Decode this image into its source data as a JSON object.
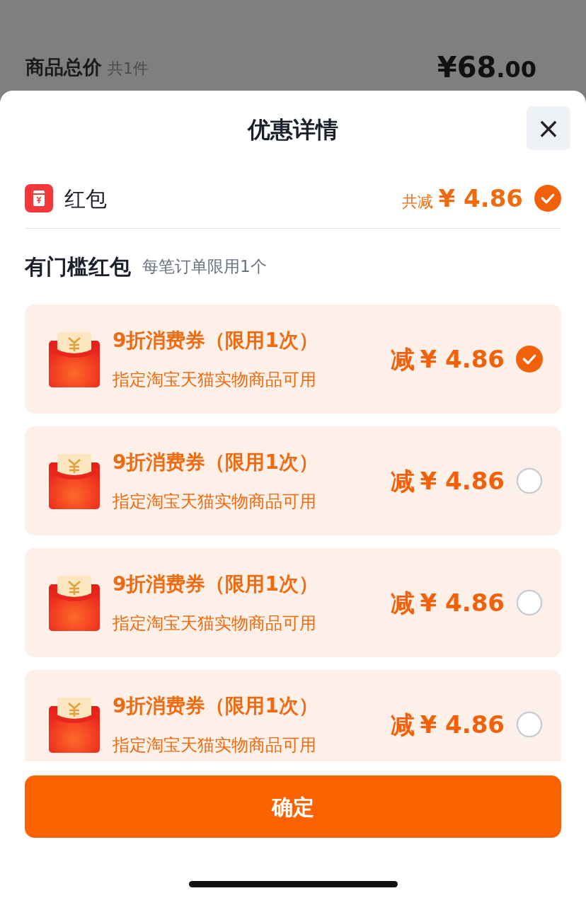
{
  "background": {
    "label": "商品总价",
    "count": "共1件",
    "price_main": "¥68",
    "price_decimal": ".00"
  },
  "sheet": {
    "title": "优惠详情",
    "close": "×"
  },
  "red_packet": {
    "label": "红包",
    "total_label": "共减",
    "total_amount": "¥ 4.86",
    "checked": true
  },
  "section": {
    "title": "有门槛红包",
    "note": "每笔订单限用1个"
  },
  "coupons": [
    {
      "title": "9折消费券（限用1次）",
      "desc": "指定淘宝天猫实物商品可用",
      "prefix": "减",
      "amount": "¥ 4.86",
      "selected": true
    },
    {
      "title": "9折消费券（限用1次）",
      "desc": "指定淘宝天猫实物商品可用",
      "prefix": "减",
      "amount": "¥ 4.86",
      "selected": false
    },
    {
      "title": "9折消费券（限用1次）",
      "desc": "指定淘宝天猫实物商品可用",
      "prefix": "减",
      "amount": "¥ 4.86",
      "selected": false
    },
    {
      "title": "9折消费券（限用1次）",
      "desc": "指定淘宝天猫实物商品可用",
      "prefix": "减",
      "amount": "¥ 4.86",
      "selected": false
    }
  ],
  "confirm": "确定"
}
